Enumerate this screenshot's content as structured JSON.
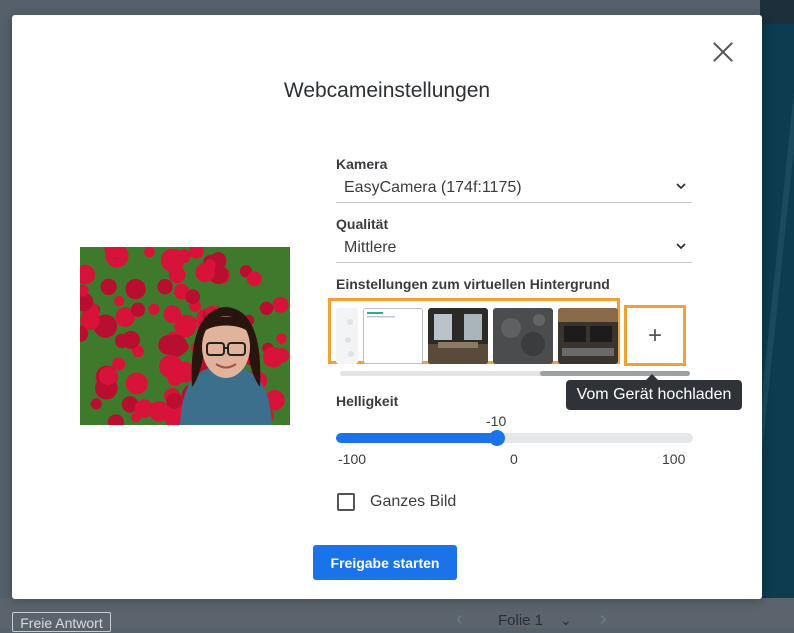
{
  "background": {
    "free_answer_label": "Freie Antwort",
    "slide_label": "Folie 1"
  },
  "modal": {
    "title": "Webcameinstellungen",
    "camera": {
      "label": "Kamera",
      "value": "EasyCamera (174f:1175)"
    },
    "quality": {
      "label": "Qualität",
      "value": "Mittlere"
    },
    "virtual_bg": {
      "label": "Einstellungen zum virtuellen Hintergrund",
      "thumbnails": [
        "blur",
        "document",
        "office-room",
        "concrete-texture",
        "conference-room"
      ],
      "upload_icon": "plus-icon",
      "upload_tooltip": "Vom Gerät hochladen",
      "scroll_position": 0.57
    },
    "brightness": {
      "label": "Helligkeit",
      "value": "-10",
      "value_numeric": -10,
      "min": "-100",
      "mid": "0",
      "max": "100",
      "min_numeric": -100,
      "max_numeric": 100
    },
    "full_image": {
      "label": "Ganzes Bild",
      "checked": false
    },
    "start_button": "Freigabe starten",
    "colors": {
      "accent": "#1a73e8",
      "highlight": "#f0a137"
    }
  }
}
